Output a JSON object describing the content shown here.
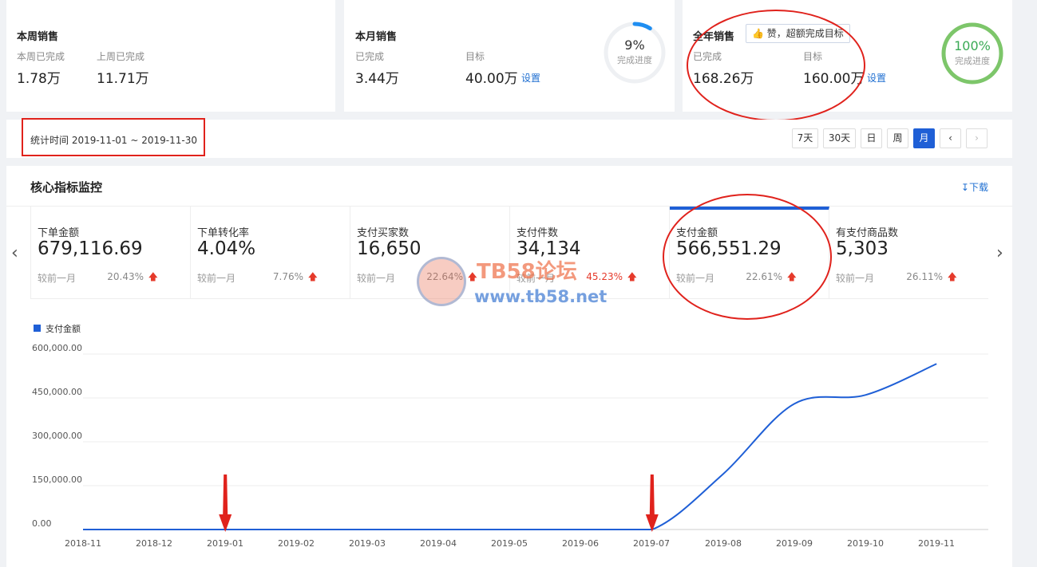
{
  "weekly": {
    "title": "本周销售",
    "this_week_label": "本周已完成",
    "this_week_value": "1.78万",
    "last_week_label": "上周已完成",
    "last_week_value": "11.71万"
  },
  "monthly": {
    "title": "本月销售",
    "done_label": "已完成",
    "done_value": "3.44万",
    "target_label": "目标",
    "target_value": "40.00万",
    "set_link": "设置",
    "progress_pct": "9%",
    "progress_label": "完成进度",
    "progress": 0.09
  },
  "yearly": {
    "title": "全年销售",
    "badge": "赞，超额完成目标",
    "done_label": "已完成",
    "done_value": "168.26万",
    "target_label": "目标",
    "target_value": "160.00万",
    "set_link": "设置",
    "progress_pct": "100%",
    "progress_label": "完成进度",
    "progress": 1.0
  },
  "period": {
    "text": "统计时间 2019-11-01 ~ 2019-11-30",
    "buttons": [
      "7天",
      "30天",
      "日",
      "周",
      "月"
    ],
    "active": "月"
  },
  "core": {
    "title": "核心指标监控",
    "download": "下载",
    "compare_label": "较前一月",
    "metrics": [
      {
        "label": "下单金额",
        "value": "679,116.69",
        "pct": "20.43%"
      },
      {
        "label": "下单转化率",
        "value": "4.04%",
        "pct": "7.76%"
      },
      {
        "label": "支付买家数",
        "value": "16,650",
        "pct": "22.64%"
      },
      {
        "label": "支付件数",
        "value": "34,134",
        "pct": "45.23%"
      },
      {
        "label": "支付金额",
        "value": "566,551.29",
        "pct": "22.61%"
      },
      {
        "label": "有支付商品数",
        "value": "5,303",
        "pct": "26.11%"
      }
    ]
  },
  "watermark": {
    "name": "TB58论坛",
    "url": "www.tb58.net"
  },
  "colors": {
    "accent": "#1f5fd6",
    "up_arrow": "#e53a2b",
    "annotation": "#e0221c",
    "ring_done": "#7dc66a"
  },
  "chart_data": {
    "type": "line",
    "legend": "支付金额",
    "x": [
      "2018-11",
      "2018-12",
      "2019-01",
      "2019-02",
      "2019-03",
      "2019-04",
      "2019-05",
      "2019-06",
      "2019-07",
      "2019-08",
      "2019-09",
      "2019-10",
      "2019-11"
    ],
    "series": [
      {
        "name": "支付金额",
        "values": [
          0,
          0,
          0,
          0,
          0,
          0,
          0,
          0,
          0,
          190000,
          430000,
          460000,
          566551.29
        ]
      }
    ],
    "yticks": [
      "0.00",
      "150,000.00",
      "300,000.00",
      "450,000.00",
      "600,000.00"
    ],
    "ylim": [
      0,
      600000
    ],
    "grid": true,
    "legend_position": "top-left"
  }
}
